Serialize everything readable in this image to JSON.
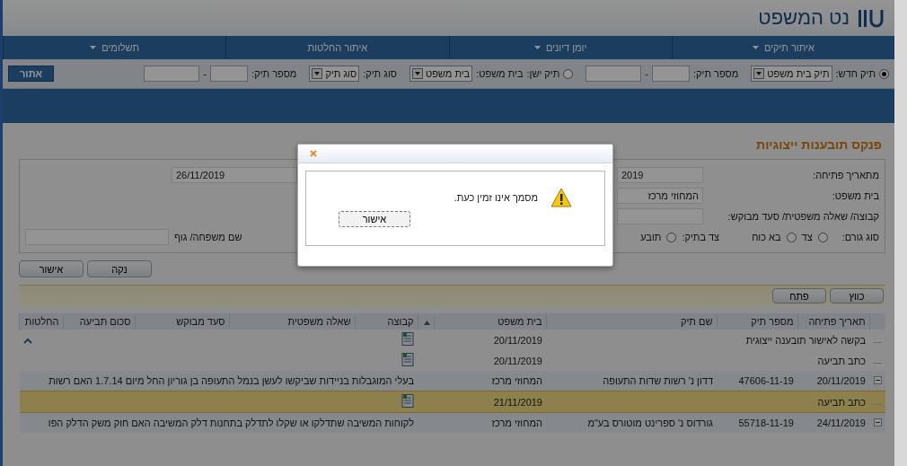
{
  "header": {
    "title": "נט המשפט"
  },
  "nav": [
    {
      "label": "איתור תיקים",
      "dropdown": true
    },
    {
      "label": "יומן דיונים",
      "dropdown": true
    },
    {
      "label": "איתור החלטות",
      "dropdown": false
    },
    {
      "label": "תשלומים",
      "dropdown": true
    }
  ],
  "case_search": {
    "new_case": {
      "label": "תיק חדש:",
      "selected": true,
      "type_value": "תיק בית משפט",
      "number_label": "מספר תיק:"
    },
    "old_case": {
      "label": "תיק ישן:",
      "selected": false,
      "court_label": "בית משפט:",
      "court_value": "בית משפט",
      "type_label": "סוג תיק:",
      "type_value": "סוג תיק",
      "number_label": "מספר תיק:"
    },
    "separator": "-",
    "button": "אתור"
  },
  "page_title": "פנקס תובענות ייצוגיות",
  "filters": {
    "from_date": {
      "label": "מתאריך פתיחה:",
      "value": "2019"
    },
    "to_date": {
      "value": "26/11/2019"
    },
    "court": {
      "label": "בית משפט:",
      "value": "המחוזי מרכז"
    },
    "topic": {
      "label": "קבוצה/ שאלה משפטית/ סעד מבוקש:"
    },
    "entity_type": {
      "label": "סוג גורם:",
      "options": [
        {
          "label": "צד",
          "selected": false
        },
        {
          "label": "בא כוח",
          "selected": false
        }
      ]
    },
    "case_side": {
      "label": "צד בתיק:",
      "options": [
        {
          "label": "תובע",
          "selected": false
        }
      ]
    },
    "family_name": {
      "label": "שם משפחה/ גוף"
    }
  },
  "filter_buttons": [
    "נקה",
    "אישור"
  ],
  "results_toolbar": {
    "buttons": [
      "כווץ",
      "פתח"
    ]
  },
  "table": {
    "columns": [
      "תאריך פתיחה",
      "מספר תיק",
      "שם תיק",
      "בית משפט",
      "קבוצה",
      "שאלה משפטית",
      "סעד מבוקש",
      "סכום תביעה",
      "החלטות"
    ],
    "rows": [
      {
        "kind": "document",
        "name": "בקשה לאישור תובענה ייצוגית",
        "date": "20/11/2019",
        "selected": false
      },
      {
        "kind": "document",
        "name": "כתב תביעה",
        "date": "20/11/2019",
        "selected": false
      },
      {
        "kind": "case",
        "expanded": true,
        "date": "20/11/2019",
        "number": "47606-11-19",
        "name": "דדון נ' רשות שדות התעופה",
        "court": "המחוזי מרכז",
        "summary": "בעלי המוגבלות בניידות שביקשו לעשן בנמל התעופה בן גוריון החל מיום 1.7.14 האם רשות",
        "selected": false
      },
      {
        "kind": "document",
        "name": "כתב תביעה",
        "date": "21/11/2019",
        "selected": true
      },
      {
        "kind": "case",
        "expanded": true,
        "date": "24/11/2019",
        "number": "55718-11-19",
        "name": "גורדוס נ' ספרינט מוטורס בע\"מ",
        "court": "המחוזי מרכז",
        "summary": "לקוחות המשיבה שתדלקו או שקלו לתדלק בתחנות דלק המשיבה האם חוק משק הדלק הפו",
        "selected": false
      }
    ]
  },
  "dialog": {
    "message": "מסמך אינו זמין כעת.",
    "button": "אישור"
  }
}
